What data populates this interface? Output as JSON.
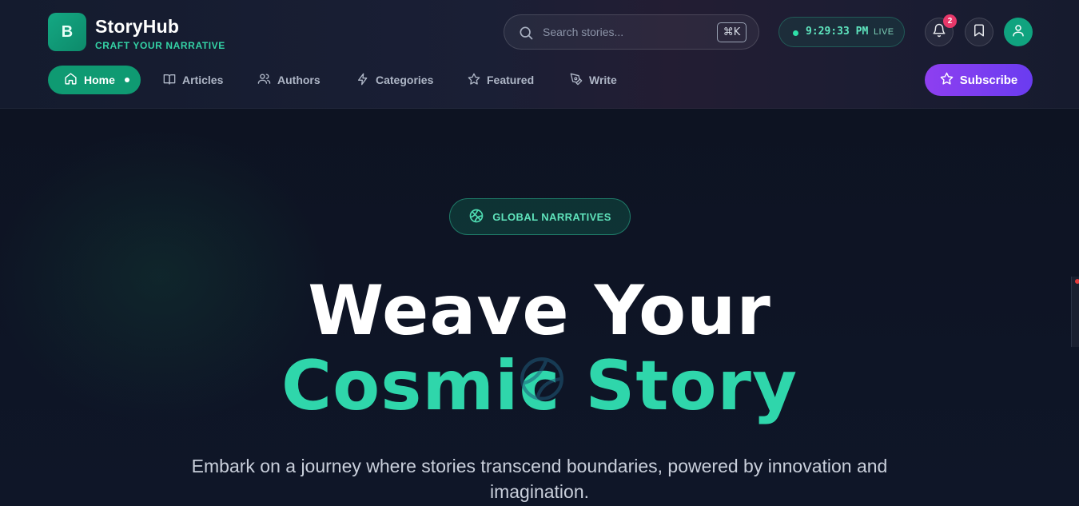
{
  "brand": {
    "logo_letter": "B",
    "name": "StoryHub",
    "tagline": "CRAFT YOUR NARRATIVE"
  },
  "search": {
    "placeholder": "Search stories...",
    "shortcut": "⌘K",
    "icon": "search-icon"
  },
  "clock": {
    "time": "9:29:33 PM",
    "status": "LIVE"
  },
  "notifications": {
    "icon": "bell-icon",
    "count": "2"
  },
  "bookmark": {
    "icon": "bookmark-icon"
  },
  "profile": {
    "icon": "user-icon"
  },
  "nav": {
    "items": [
      {
        "label": "Home",
        "icon": "home-icon",
        "active": true
      },
      {
        "label": "Articles",
        "icon": "book-open-icon"
      },
      {
        "label": "Authors",
        "icon": "users-icon"
      },
      {
        "label": "Categories",
        "icon": "lightning-icon"
      },
      {
        "label": "Featured",
        "icon": "star-icon"
      },
      {
        "label": "Write",
        "icon": "pen-icon"
      }
    ],
    "subscribe_label": "Subscribe"
  },
  "hero": {
    "badge": "GLOBAL NARRATIVES",
    "headline_line1": "Weave Your",
    "headline_line2": "Cosmic Story",
    "subtitle": "Embark on a journey where stories transcend boundaries, powered by innovation and imagination."
  },
  "colors": {
    "accent": "#2fd6ab",
    "brand_green": "#0f9a72",
    "subscribe": "#7b3ff0",
    "badge_red": "#e7386a",
    "background": "#0f1424"
  }
}
